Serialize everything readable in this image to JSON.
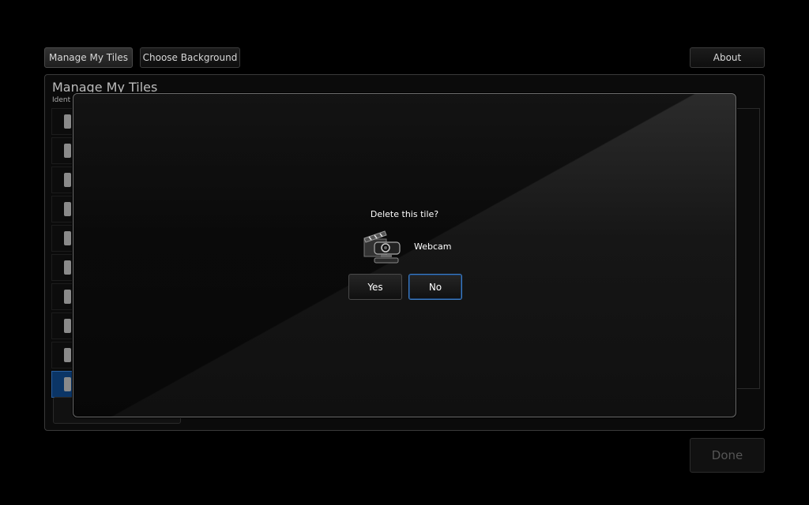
{
  "toolbar": {
    "manage_label": "Manage My Tiles",
    "background_label": "Choose Background",
    "about_label": "About"
  },
  "panel": {
    "title": "Manage My Tiles",
    "subtitle": "Ident"
  },
  "dialog": {
    "question": "Delete this tile?",
    "tile_name": "Webcam",
    "tile_icon": "webcam-clapperboard-icon",
    "yes_label": "Yes",
    "no_label": "No"
  },
  "footer": {
    "done_label": "Done"
  }
}
